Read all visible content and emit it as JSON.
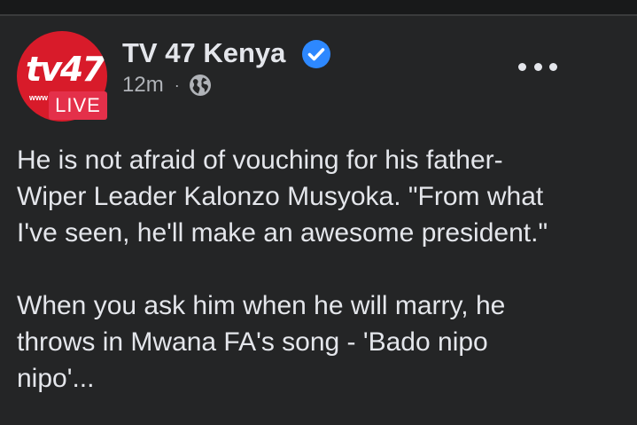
{
  "post": {
    "page_name": "TV 47 Kenya",
    "timestamp": "12m",
    "separator": "·",
    "avatar": {
      "logo_text": "tv47",
      "small_text": "www",
      "live_label": "LIVE",
      "brand_color": "#d81b2a"
    },
    "icons": {
      "verified": "verified-badge-icon",
      "audience": "globe-icon",
      "more": "more-options-icon"
    },
    "paragraphs": [
      "He is not afraid of vouching for his father-\nWiper Leader Kalonzo Musyoka. \"From what\nI've seen, he'll make an awesome president.\"",
      "When you ask him when he will marry, he\nthrows in Mwana FA's song - 'Bado nipo\nnipo'..."
    ]
  },
  "colors": {
    "background": "#242526",
    "text_primary": "#e4e6eb",
    "text_secondary": "#b0b3b8",
    "verified": "#2d88ff",
    "live_badge": "#e4304a"
  }
}
